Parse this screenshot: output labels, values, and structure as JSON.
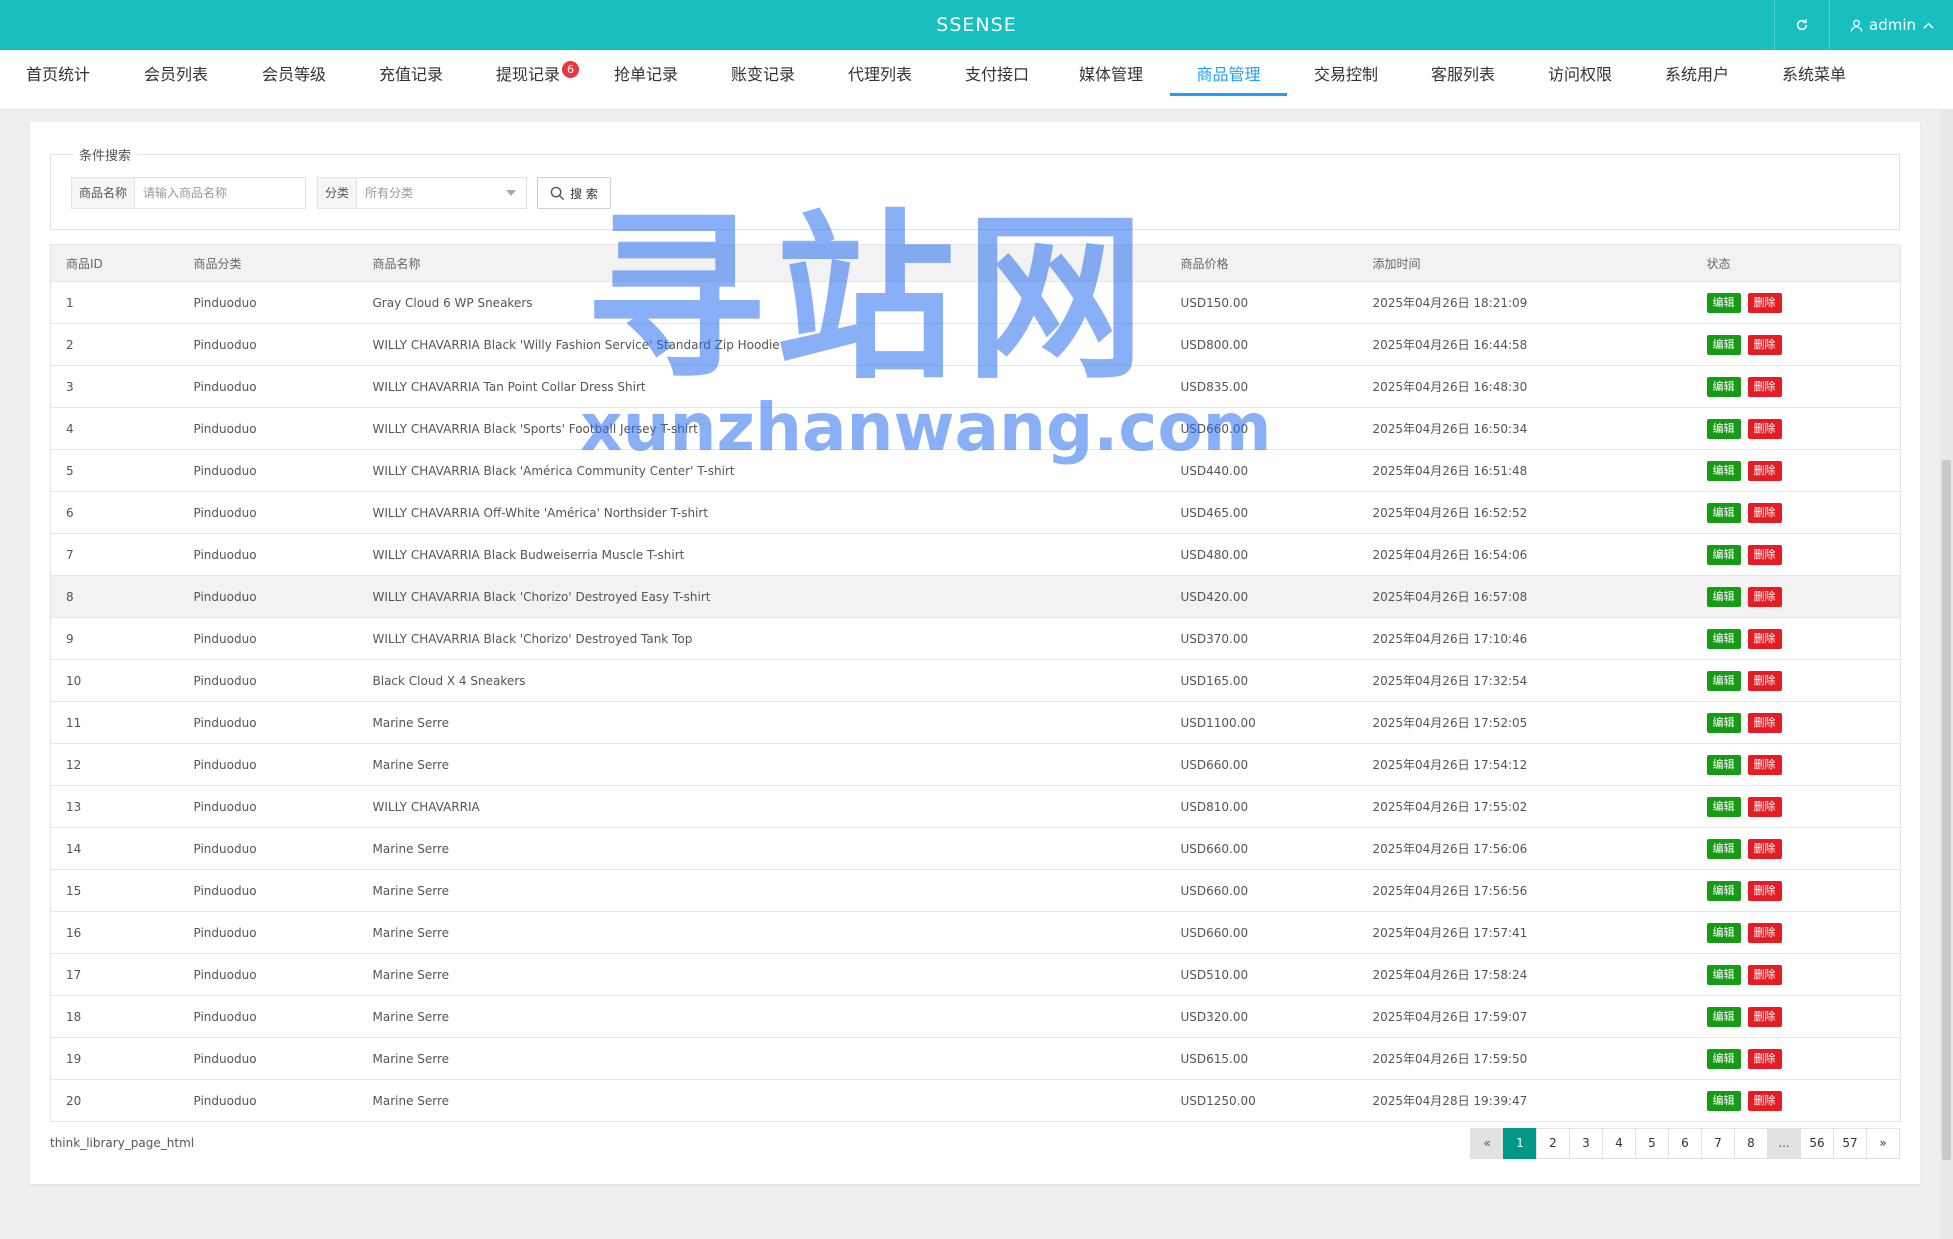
{
  "header": {
    "brand": "SSENSE",
    "user": "admin",
    "colors": {
      "topbar": "#17bfbf",
      "nav_active": "#1e9fff",
      "badge": "#e8383d"
    }
  },
  "nav": {
    "items": [
      {
        "label": "首页统计"
      },
      {
        "label": "会员列表"
      },
      {
        "label": "会员等级"
      },
      {
        "label": "充值记录"
      },
      {
        "label": "提现记录",
        "badge": "6"
      },
      {
        "label": "抢单记录"
      },
      {
        "label": "账变记录"
      },
      {
        "label": "代理列表"
      },
      {
        "label": "支付接口"
      },
      {
        "label": "媒体管理"
      },
      {
        "label": "商品管理",
        "active": true
      },
      {
        "label": "交易控制"
      },
      {
        "label": "客服列表"
      },
      {
        "label": "访问权限"
      },
      {
        "label": "系统用户"
      },
      {
        "label": "系统菜单"
      }
    ]
  },
  "search": {
    "legend": "条件搜索",
    "name_label": "商品名称",
    "name_placeholder": "请输入商品名称",
    "category_label": "分类",
    "category_value": "所有分类",
    "button": "搜 索"
  },
  "table": {
    "headers": [
      "商品ID",
      "商品分类",
      "商品名称",
      "商品价格",
      "添加时间",
      "状态"
    ],
    "edit_label": "编辑",
    "delete_label": "删除",
    "rows": [
      {
        "id": "1",
        "category": "Pinduoduo",
        "name": "Gray Cloud 6 WP Sneakers",
        "price": "USD150.00",
        "time": "2025年04月26日 18:21:09"
      },
      {
        "id": "2",
        "category": "Pinduoduo",
        "name": "WILLY CHAVARRIA Black 'Willy Fashion Service' Standard Zip Hoodie",
        "price": "USD800.00",
        "time": "2025年04月26日 16:44:58"
      },
      {
        "id": "3",
        "category": "Pinduoduo",
        "name": "WILLY CHAVARRIA Tan Point Collar Dress Shirt",
        "price": "USD835.00",
        "time": "2025年04月26日 16:48:30"
      },
      {
        "id": "4",
        "category": "Pinduoduo",
        "name": "WILLY CHAVARRIA Black 'Sports' Football Jersey T-shirt",
        "price": "USD660.00",
        "time": "2025年04月26日 16:50:34"
      },
      {
        "id": "5",
        "category": "Pinduoduo",
        "name": "WILLY CHAVARRIA Black 'América Community Center' T-shirt",
        "price": "USD440.00",
        "time": "2025年04月26日 16:51:48"
      },
      {
        "id": "6",
        "category": "Pinduoduo",
        "name": "WILLY CHAVARRIA Off-White 'América' Northsider T-shirt",
        "price": "USD465.00",
        "time": "2025年04月26日 16:52:52"
      },
      {
        "id": "7",
        "category": "Pinduoduo",
        "name": "WILLY CHAVARRIA Black Budweiserria Muscle T-shirt",
        "price": "USD480.00",
        "time": "2025年04月26日 16:54:06"
      },
      {
        "id": "8",
        "category": "Pinduoduo",
        "name": "WILLY CHAVARRIA Black 'Chorizo' Destroyed Easy T-shirt",
        "price": "USD420.00",
        "time": "2025年04月26日 16:57:08",
        "highlight": true
      },
      {
        "id": "9",
        "category": "Pinduoduo",
        "name": "WILLY CHAVARRIA Black 'Chorizo' Destroyed Tank Top",
        "price": "USD370.00",
        "time": "2025年04月26日 17:10:46"
      },
      {
        "id": "10",
        "category": "Pinduoduo",
        "name": "Black Cloud X 4 Sneakers",
        "price": "USD165.00",
        "time": "2025年04月26日 17:32:54"
      },
      {
        "id": "11",
        "category": "Pinduoduo",
        "name": "Marine Serre",
        "price": "USD1100.00",
        "time": "2025年04月26日 17:52:05"
      },
      {
        "id": "12",
        "category": "Pinduoduo",
        "name": "Marine Serre",
        "price": "USD660.00",
        "time": "2025年04月26日 17:54:12"
      },
      {
        "id": "13",
        "category": "Pinduoduo",
        "name": "WILLY CHAVARRIA",
        "price": "USD810.00",
        "time": "2025年04月26日 17:55:02"
      },
      {
        "id": "14",
        "category": "Pinduoduo",
        "name": "Marine Serre",
        "price": "USD660.00",
        "time": "2025年04月26日 17:56:06"
      },
      {
        "id": "15",
        "category": "Pinduoduo",
        "name": "Marine Serre",
        "price": "USD660.00",
        "time": "2025年04月26日 17:56:56"
      },
      {
        "id": "16",
        "category": "Pinduoduo",
        "name": "Marine Serre",
        "price": "USD660.00",
        "time": "2025年04月26日 17:57:41"
      },
      {
        "id": "17",
        "category": "Pinduoduo",
        "name": "Marine Serre",
        "price": "USD510.00",
        "time": "2025年04月26日 17:58:24"
      },
      {
        "id": "18",
        "category": "Pinduoduo",
        "name": "Marine Serre",
        "price": "USD320.00",
        "time": "2025年04月26日 17:59:07"
      },
      {
        "id": "19",
        "category": "Pinduoduo",
        "name": "Marine Serre",
        "price": "USD615.00",
        "time": "2025年04月26日 17:59:50"
      },
      {
        "id": "20",
        "category": "Pinduoduo",
        "name": "Marine Serre",
        "price": "USD1250.00",
        "time": "2025年04月28日 19:39:47"
      }
    ]
  },
  "footer": {
    "text": "think_library_page_html"
  },
  "pagination": {
    "pages": [
      {
        "label": "«",
        "kind": "muted"
      },
      {
        "label": "1",
        "kind": "current"
      },
      {
        "label": "2"
      },
      {
        "label": "3"
      },
      {
        "label": "4"
      },
      {
        "label": "5"
      },
      {
        "label": "6"
      },
      {
        "label": "7"
      },
      {
        "label": "8"
      },
      {
        "label": "...",
        "kind": "muted"
      },
      {
        "label": "56"
      },
      {
        "label": "57"
      },
      {
        "label": "»"
      }
    ]
  },
  "watermark": {
    "cn": "寻站网",
    "en": "xunzhanwang.com"
  }
}
